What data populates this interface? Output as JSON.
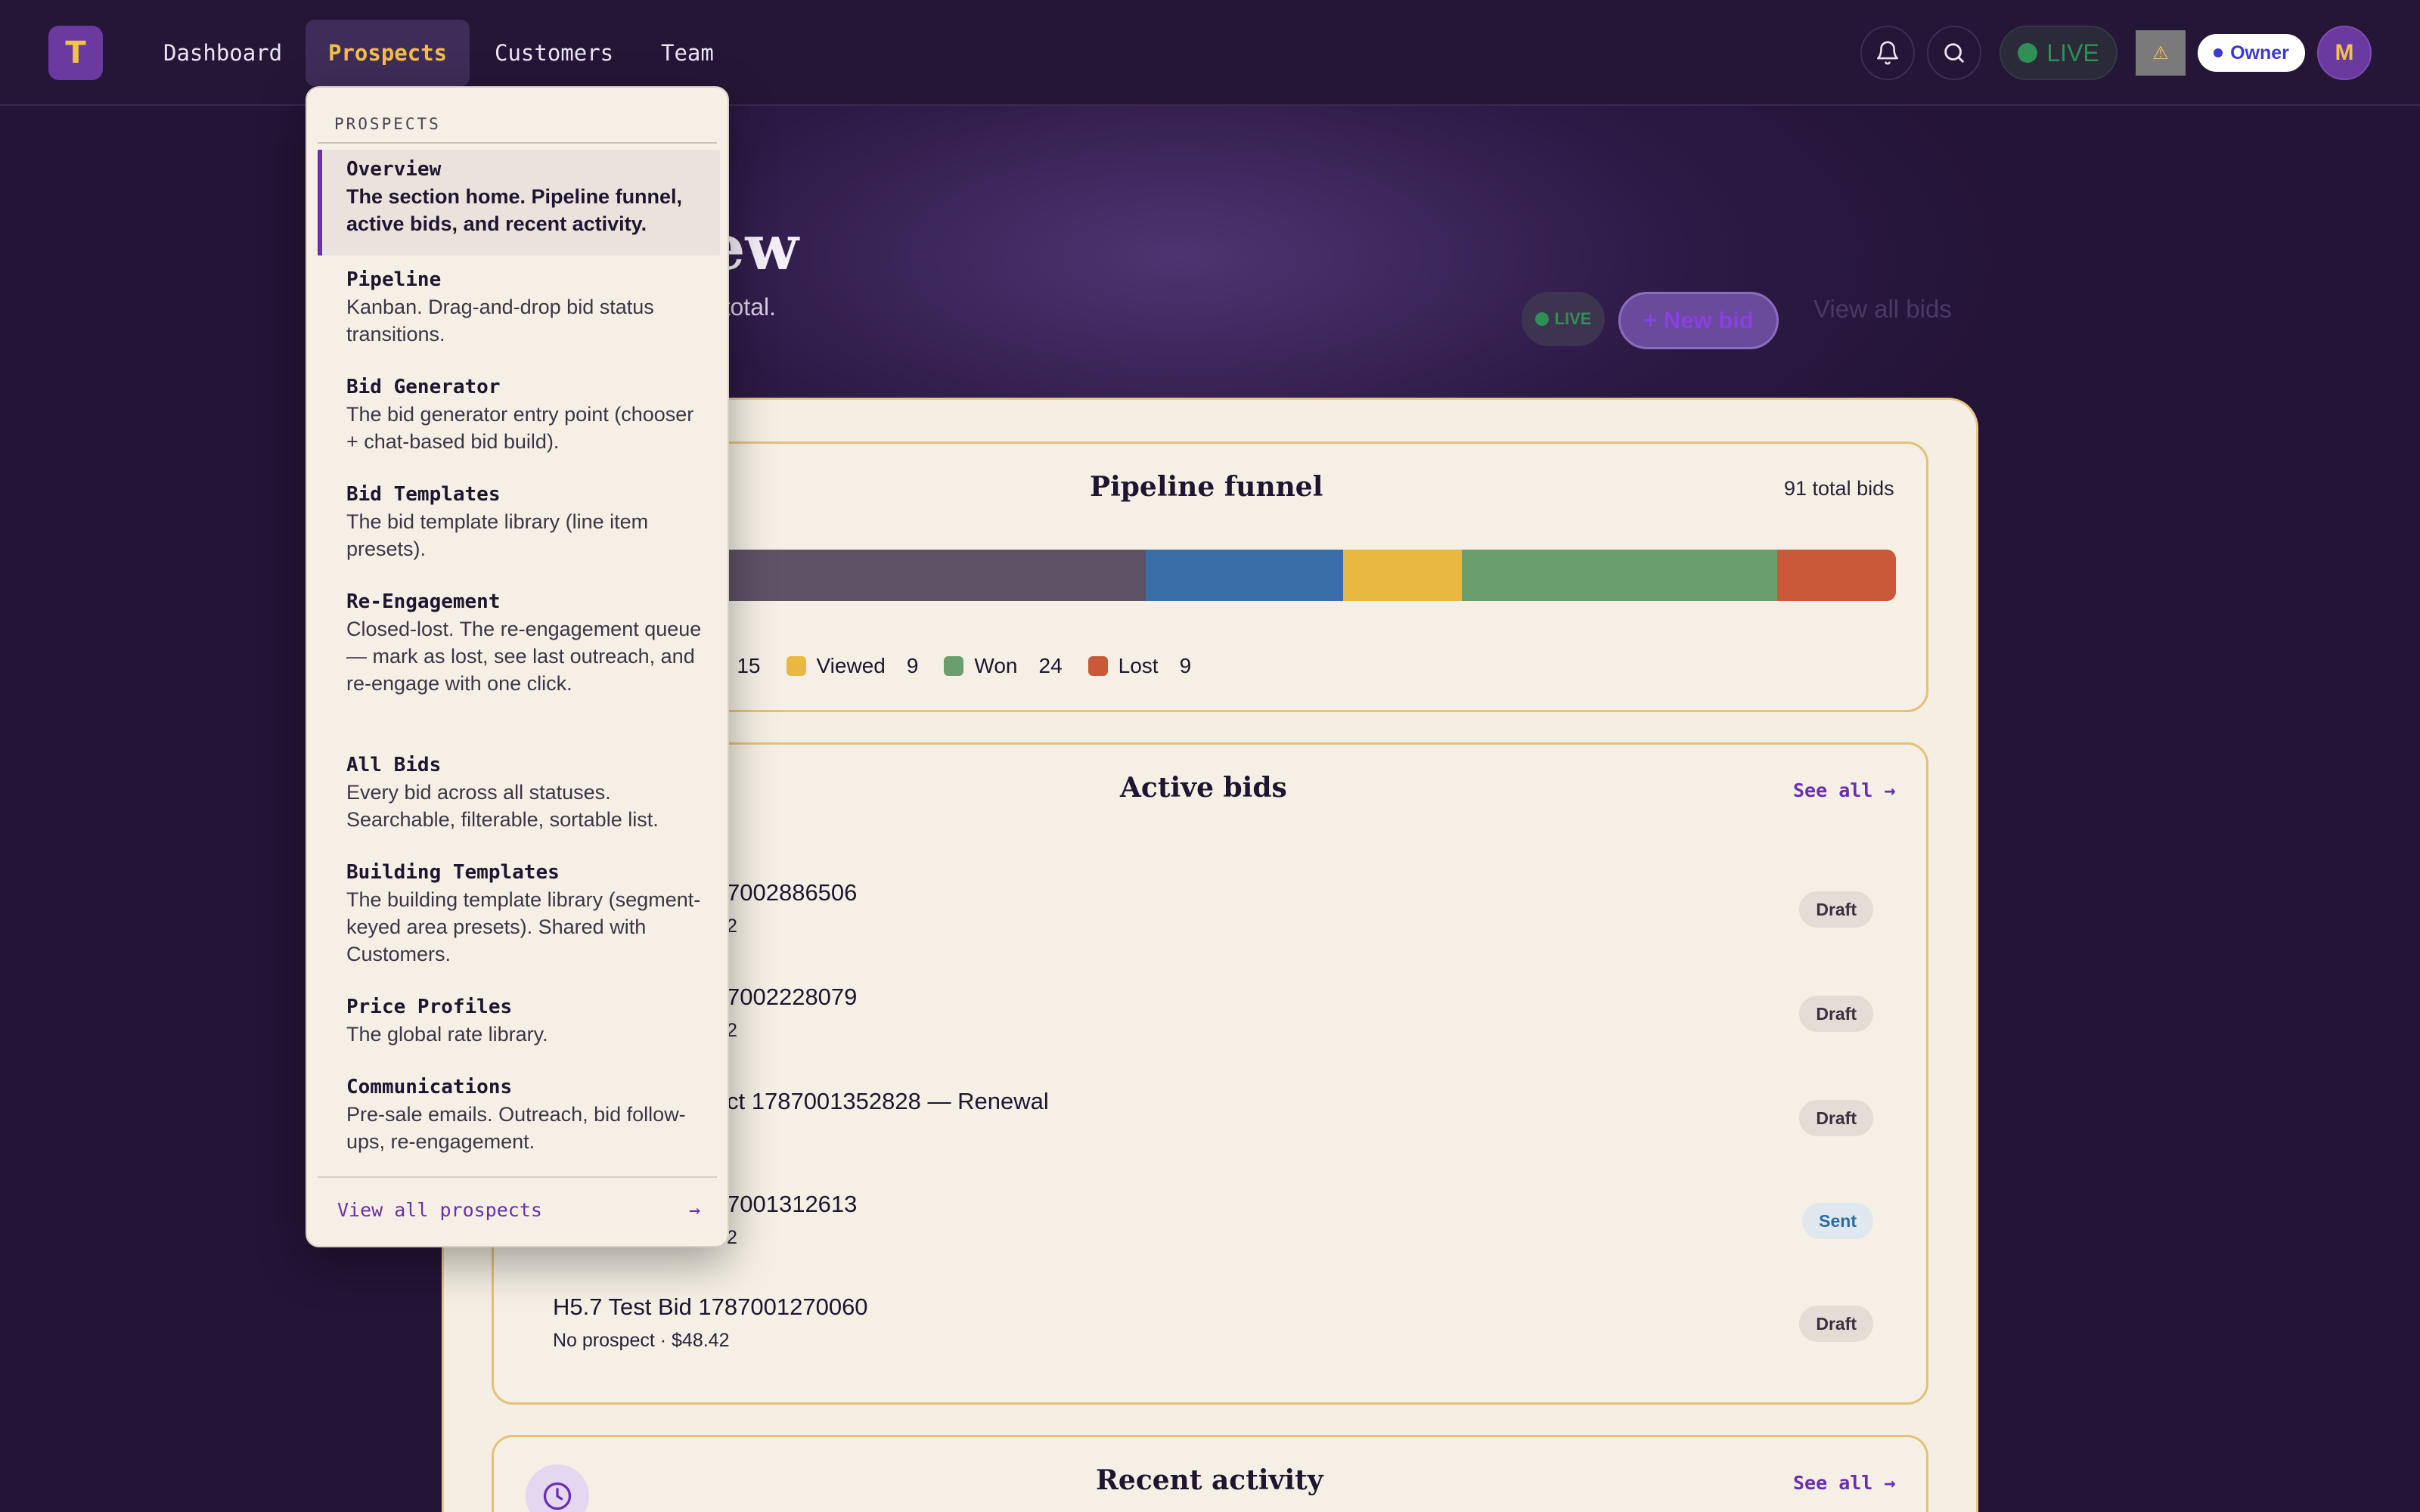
{
  "app": {
    "logo_letter": "T",
    "nav": [
      {
        "label": "Dashboard",
        "active": false
      },
      {
        "label": "Prospects",
        "active": true
      },
      {
        "label": "Customers",
        "active": false
      },
      {
        "label": "Team",
        "active": false
      }
    ],
    "live_label": "LIVE",
    "env_chip": "⚠",
    "role_label": "Owner",
    "avatar_initial": "M"
  },
  "header": {
    "title": "Overview",
    "subtitle": "ing new work. 91 bids total.",
    "live_label": "LIVE",
    "new_bid_label": "+ New bid",
    "view_all_label": "View all bids"
  },
  "funnel": {
    "title": "Pipeline funnel",
    "total_label": "91 total bids",
    "legend_partial": {
      "label": "nt",
      "count": "15"
    },
    "legend": [
      {
        "label": "Viewed",
        "count": "9",
        "color": "#e8b840"
      },
      {
        "label": "Won",
        "count": "24",
        "color": "#6a9e6e"
      },
      {
        "label": "Lost",
        "count": "9",
        "color": "#c85a3a"
      }
    ],
    "segments": [
      {
        "value": 34,
        "color": "#5e5266"
      },
      {
        "value": 15,
        "color": "#3a6ea8"
      },
      {
        "value": 9,
        "color": "#e8b840"
      },
      {
        "value": 24,
        "color": "#6a9e6e"
      },
      {
        "value": 9,
        "color": "#c85a3a"
      }
    ]
  },
  "active_bids": {
    "title": "Active bids",
    "see_all": "See all →",
    "rows": [
      {
        "title": "7002886506",
        "meta": "2",
        "status": "Draft"
      },
      {
        "title": "7002228079",
        "meta": "2",
        "status": "Draft"
      },
      {
        "title": "ct 1787001352828 — Renewal",
        "meta": "",
        "status": "Draft"
      },
      {
        "title": "7001312613",
        "meta": "2",
        "status": "Sent"
      },
      {
        "title": "H5.7 Test Bid 1787001270060",
        "meta": "No prospect · $48.42",
        "status": "Draft"
      }
    ]
  },
  "recent_activity": {
    "title": "Recent activity",
    "see_all": "See all →"
  },
  "dropdown": {
    "header": "PROSPECTS",
    "items": [
      {
        "name": "Overview",
        "desc": "The section home. Pipeline funnel, active bids, and recent activity.",
        "active": true
      },
      {
        "name": "Pipeline",
        "desc": "Kanban. Drag-and-drop bid status transitions.",
        "active": false
      },
      {
        "name": "Bid Generator",
        "desc": "The bid generator entry point (chooser + chat-based bid build).",
        "active": false
      },
      {
        "name": "Bid Templates",
        "desc": "The bid template library (line item presets).",
        "active": false
      },
      {
        "name": "Re-Engagement",
        "desc": "Closed-lost. The re-engagement queue — mark as lost, see last outreach, and re-engage with one click.",
        "active": false
      },
      {
        "name": "All Bids",
        "desc": "Every bid across all statuses. Searchable, filterable, sortable list.",
        "active": false
      },
      {
        "name": "Building Templates",
        "desc": "The building template library (segment-keyed area presets). Shared with Customers.",
        "active": false
      },
      {
        "name": "Price Profiles",
        "desc": "The global rate library.",
        "active": false
      },
      {
        "name": "Communications",
        "desc": "Pre-sale emails. Outreach, bid follow-ups, re-engagement.",
        "active": false
      }
    ],
    "footer_label": "View all prospects",
    "footer_arrow": "→"
  }
}
